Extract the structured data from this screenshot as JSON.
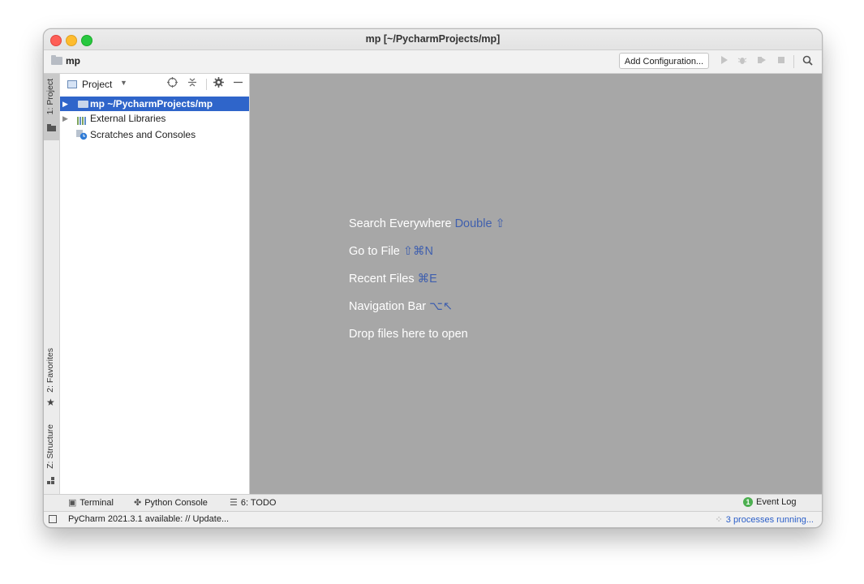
{
  "window": {
    "title": "mp [~/PycharmProjects/mp]"
  },
  "navbar": {
    "project_name": "mp",
    "add_configuration_label": "Add Configuration...",
    "icons": [
      "run-icon",
      "debug-icon",
      "coverage-icon",
      "stop-icon",
      "search-icon"
    ]
  },
  "left_strip": {
    "project_label": "1: Project",
    "favorites_label": "2: Favorites",
    "structure_label": "Z: Structure"
  },
  "project_panel": {
    "title": "Project",
    "tree": [
      {
        "name": "mp",
        "path": "~/PycharmProjects/mp",
        "selected": true
      },
      {
        "name": "External Libraries"
      },
      {
        "name": "Scratches and Consoles"
      }
    ]
  },
  "editor": {
    "hints": [
      {
        "text": "Search Everywhere",
        "shortcut": "Double ⇧"
      },
      {
        "text": "Go to File",
        "shortcut": "⇧⌘N"
      },
      {
        "text": "Recent Files",
        "shortcut": "⌘E"
      },
      {
        "text": "Navigation Bar",
        "shortcut": "⌥↖"
      },
      {
        "text": "Drop files here to open",
        "shortcut": ""
      }
    ]
  },
  "bottom_tools": {
    "terminal": "Terminal",
    "python_console": "Python Console",
    "todo": "6: TODO",
    "event_log_badge": "1",
    "event_log": "Event Log"
  },
  "statusbar": {
    "message": "PyCharm 2021.3.1 available: // Update...",
    "processes": "3 processes running..."
  },
  "colors": {
    "selection": "#2f65ca",
    "editor_bg": "#a7a7a7",
    "shortcut": "#3f5fae",
    "event_log_badge": "#4caf50"
  }
}
